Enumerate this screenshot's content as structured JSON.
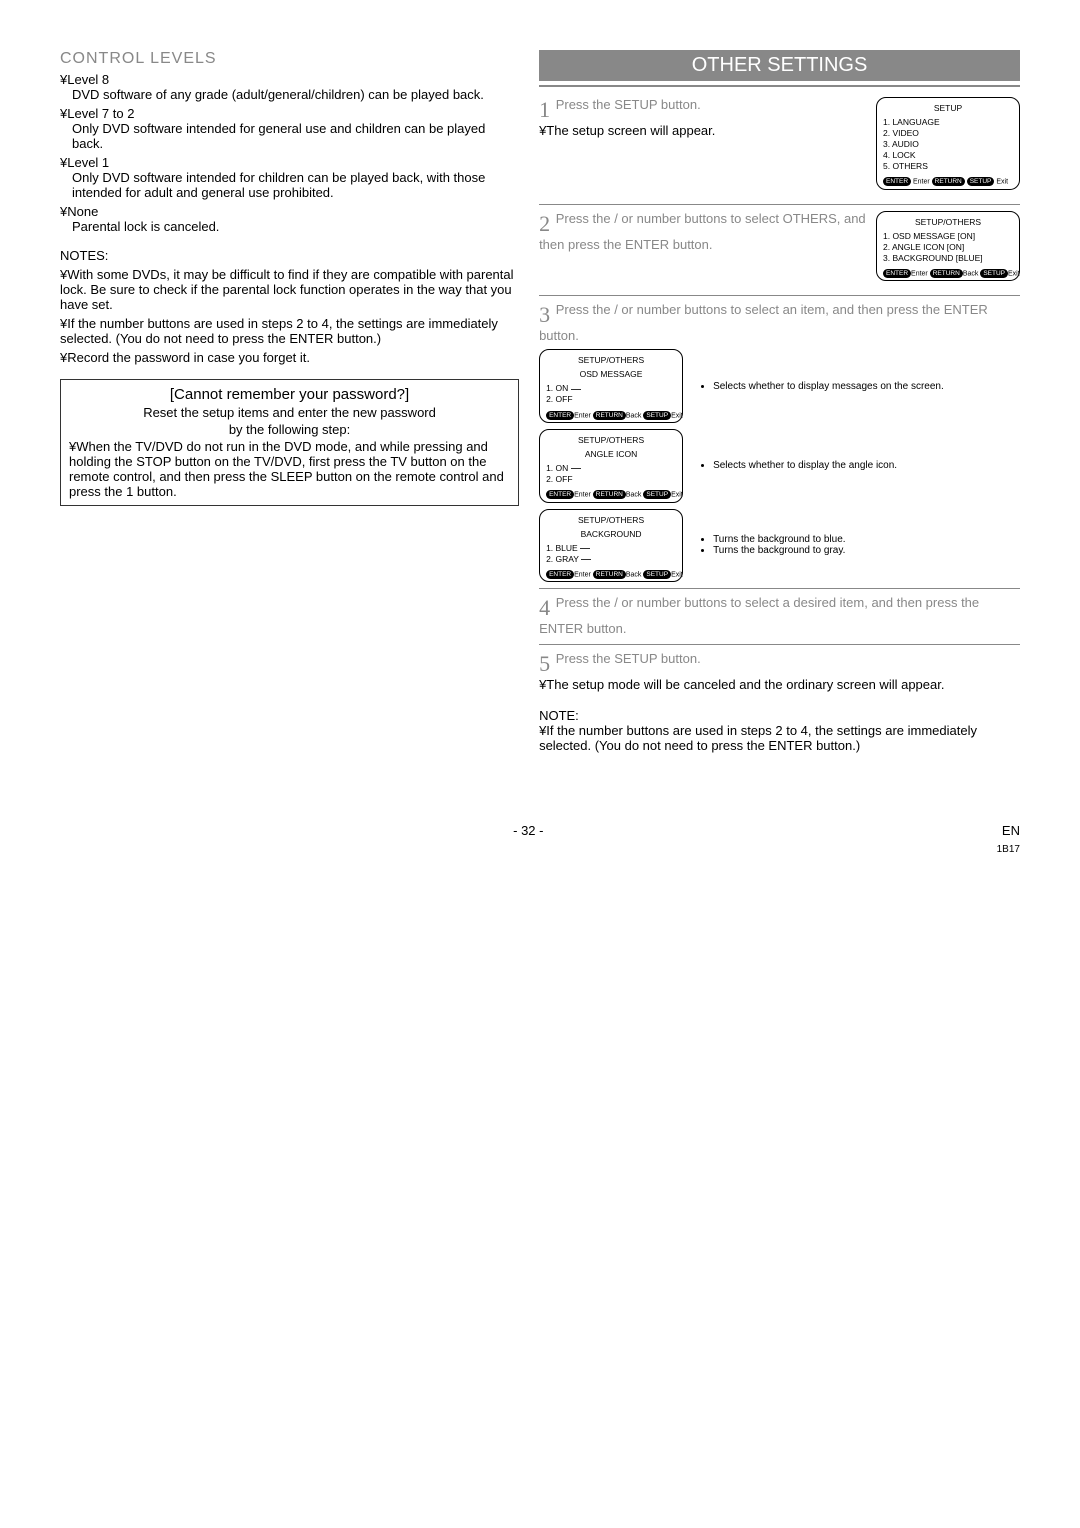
{
  "left": {
    "heading": "CONTROL LEVELS",
    "levels": [
      {
        "label": "¥Level 8",
        "text": "DVD software of any grade (adult/general/children) can be played back."
      },
      {
        "label": "¥Level 7 to 2",
        "text": "Only DVD software intended for general use and children can be played back."
      },
      {
        "label": "¥Level 1",
        "text": "Only DVD software intended for children can be played back, with those intended for adult and general use prohibited."
      },
      {
        "label": "¥None",
        "text": "Parental lock is canceled."
      }
    ],
    "notes_head": "NOTES:",
    "notes": [
      "¥With some DVDs, it may be difficult to find if they are compatible with parental lock. Be sure to check if the parental lock function operates in the way that you have set.",
      "¥If the number buttons are used in steps 2 to 4, the settings are immediately selected. (You do not need to press the ENTER button.)",
      "¥Record the password in case you forget it."
    ],
    "pw_box": {
      "title": "[Cannot remember your password?]",
      "reset1": "Reset the setup items and enter the new password",
      "reset2": "by the following step:",
      "step": "¥When the TV/DVD do not run in the DVD mode, and while pressing and holding the STOP button on the TV/DVD, first press the TV button on the remote control, and then press the SLEEP button on the remote control and press the 1 button."
    }
  },
  "right": {
    "title": "OTHER SETTINGS",
    "step1": {
      "num": "1",
      "line1": "Press the SETUP button.",
      "line2": "¥The setup screen will appear.",
      "osd": {
        "title": "SETUP",
        "items": [
          "1. LANGUAGE",
          "2. VIDEO",
          "3. AUDIO",
          "4. LOCK",
          "5. OTHERS"
        ]
      }
    },
    "step2": {
      "num": "2",
      "line1": "Press the    /    or number buttons to select OTHERS, and then press the ENTER button.",
      "osd": {
        "title": "SETUP/OTHERS",
        "items": [
          "1. OSD MESSAGE [ON]",
          "2. ANGLE ICON      [ON]",
          "3. BACKGROUND  [BLUE]"
        ]
      }
    },
    "step3": {
      "num": "3",
      "line1": "Press the    /    or number buttons to select an item, and then press the ENTER button.",
      "panels": [
        {
          "title": "SETUP/OTHERS",
          "sub": "OSD MESSAGE",
          "items": [
            "1. ON",
            "2. OFF"
          ],
          "desc": "Selects whether to display messages on the screen."
        },
        {
          "title": "SETUP/OTHERS",
          "sub": "ANGLE ICON",
          "items": [
            "1. ON",
            "2. OFF"
          ],
          "desc": "Selects whether to display the angle icon."
        },
        {
          "title": "SETUP/OTHERS",
          "sub": "BACKGROUND",
          "items": [
            "1. BLUE",
            "2. GRAY"
          ],
          "desc2": [
            "Turns the background to blue.",
            "Turns the background to gray."
          ]
        }
      ]
    },
    "step4": {
      "num": "4",
      "line1": "Press the    /    or number buttons to select a desired item, and then press the ENTER button."
    },
    "step5": {
      "num": "5",
      "line1": "Press the SETUP button.",
      "line2": "¥The setup mode will be canceled and the ordinary screen will appear."
    },
    "note_head": "NOTE:",
    "note_text": "¥If the number buttons are used in steps 2 to 4, the settings are immediately selected. (You do not need to press the ENTER button.)",
    "osd_foot": {
      "enter": "ENTER",
      "enter_t": "Enter",
      "return": "RETURN",
      "return_t": "Back",
      "setup": "SETUP",
      "setup_t": "Exit"
    }
  },
  "footer": {
    "page": "- 32 -",
    "en": "EN",
    "code": "1B17"
  }
}
